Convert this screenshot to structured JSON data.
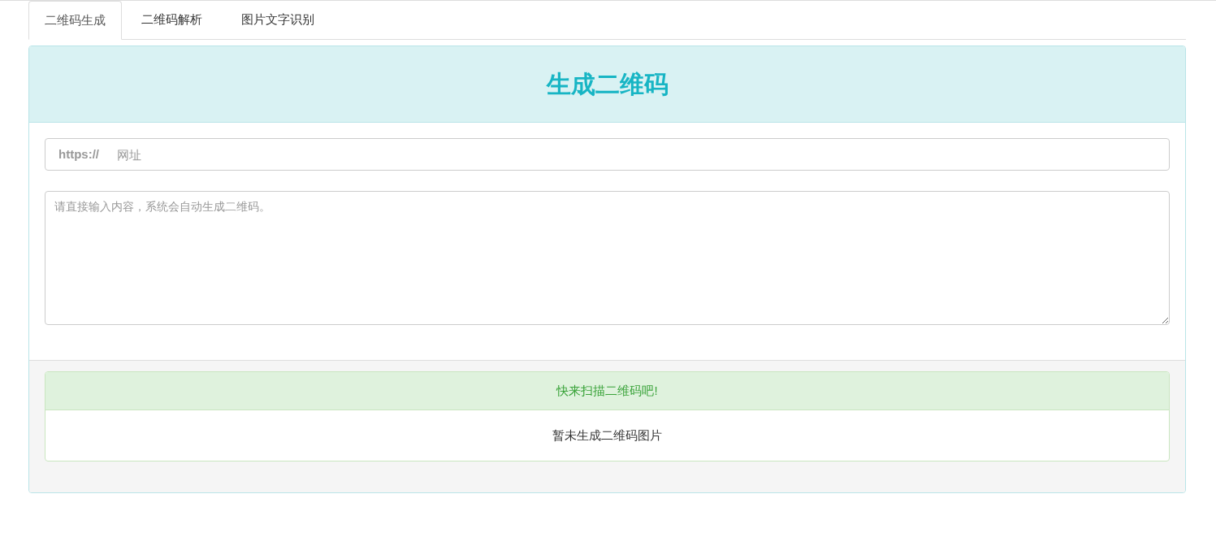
{
  "tabs": [
    {
      "label": "二维码生成",
      "selected": true
    },
    {
      "label": "二维码解析",
      "selected": false
    },
    {
      "label": "图片文字识别",
      "selected": false
    }
  ],
  "panel": {
    "title": "生成二维码",
    "url_field": {
      "prefix": "https://",
      "placeholder": "网址"
    },
    "content_field": {
      "placeholder": "请直接输入内容，系统会自动生成二维码。"
    },
    "result": {
      "heading": "快来扫描二维码吧!",
      "message": "暂未生成二维码图片"
    }
  }
}
